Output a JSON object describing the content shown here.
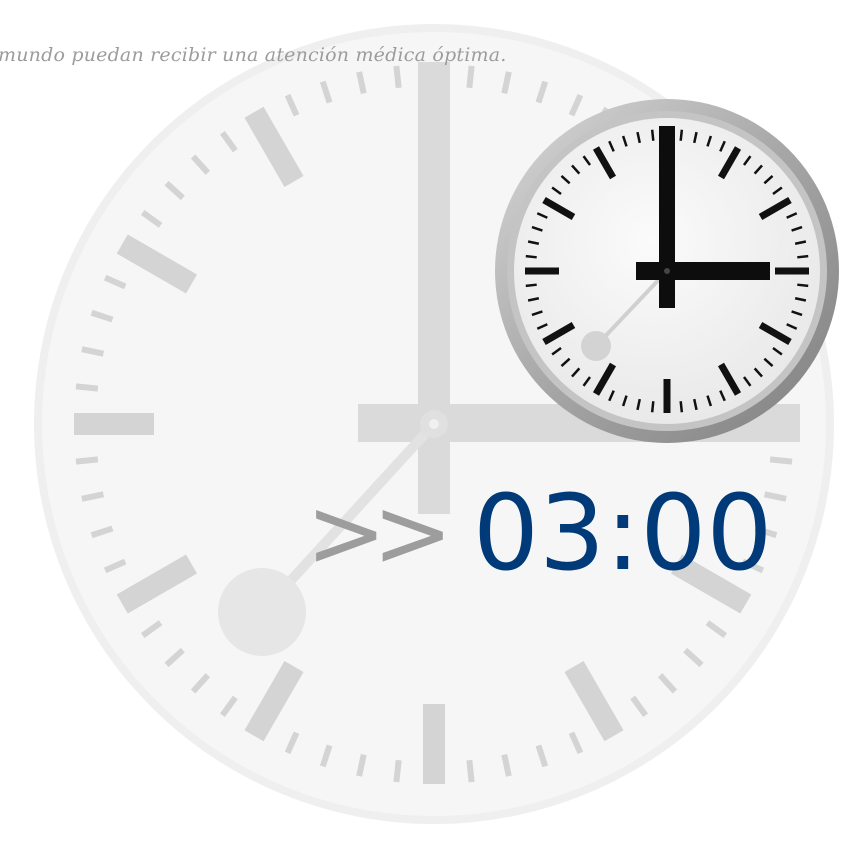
{
  "tagline": "mundo puedan recibir una atención médica óptima.",
  "display": {
    "arrows": ">>",
    "time": "03:00"
  },
  "clock_time": {
    "hours": 3,
    "minutes": 0
  },
  "colors": {
    "time_text": "#003a78",
    "arrows_text": "#9d9d9d",
    "tagline_text": "#9c9c9c",
    "background_clock": "#e8e8e8",
    "background_clock_marks": "#d4d4d4",
    "clock_face": "#f3f3f3",
    "clock_rim": "#a9a9a9",
    "clock_marks": "#111111",
    "second_hand": "#c9c9c9"
  }
}
